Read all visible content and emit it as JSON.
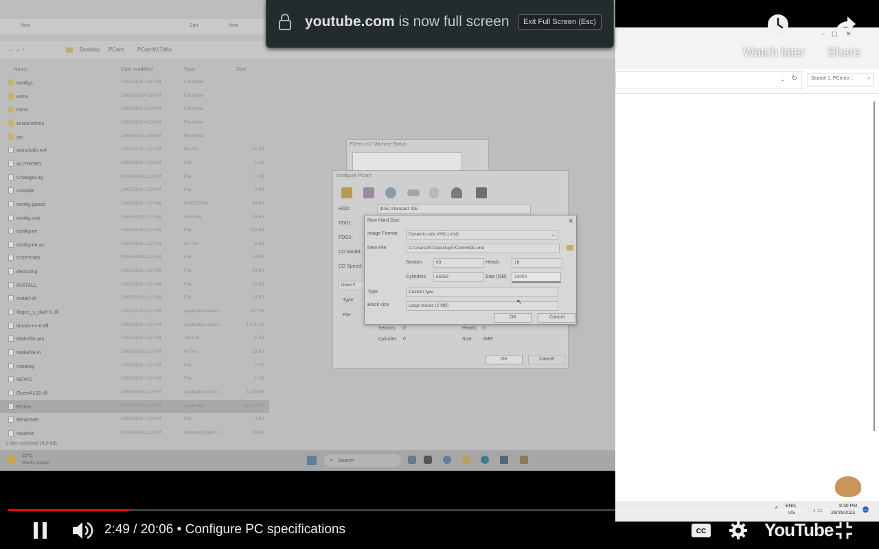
{
  "fullscreen_banner": {
    "domain": "youtube.com",
    "message": "is now full screen",
    "exit_button": "Exit Full Screen (Esc)"
  },
  "top_controls": {
    "watch_later": "Watch later",
    "share": "Share"
  },
  "player": {
    "current_time": "2:49",
    "duration": "20:06",
    "chapter": "Configure PC specifications",
    "progress": 0.14,
    "logo_text": "YouTube",
    "accent_color": "#ff0000"
  },
  "explorer": {
    "toolbar": [
      "New",
      "Sort",
      "View"
    ],
    "breadcrumb": [
      "Desktop",
      "PCem",
      "PCemV17Win"
    ],
    "columns": [
      "Name",
      "Date modified",
      "Type",
      "Size"
    ],
    "files": [
      {
        "name": "configs",
        "date": "20/05/2023 4:16 PM",
        "type": "File folder",
        "size": "",
        "icon": "folder-icon"
      },
      {
        "name": "extra",
        "date": "20/05/2023 4:16 PM",
        "type": "File folder",
        "size": "",
        "icon": "folder-icon"
      },
      {
        "name": "roms",
        "date": "20/05/2023 5:04 PM",
        "type": "File folder",
        "size": "",
        "icon": "folder-icon"
      },
      {
        "name": "screenshots",
        "date": "20/05/2023 4:25 PM",
        "type": "File folder",
        "size": "",
        "icon": "folder-icon"
      },
      {
        "name": "src",
        "date": "20/05/2023 4:16 PM",
        "type": "File folder",
        "size": "",
        "icon": "folder-icon"
      },
      {
        "name": "acinclude.m4",
        "date": "20/05/2023 1:12 PM",
        "type": "M4 File",
        "size": "60 KB",
        "icon": "file-icon"
      },
      {
        "name": "AUTHORS",
        "date": "20/05/2023 1:12 PM",
        "type": "File",
        "size": "1 KB",
        "icon": "file-icon"
      },
      {
        "name": "ChangeLog",
        "date": "20/05/2023 1:12 PM",
        "type": "File",
        "size": "1 KB",
        "icon": "file-icon"
      },
      {
        "name": "compile",
        "date": "20/05/2023 1:12 PM",
        "type": "File",
        "size": "8 KB",
        "icon": "file-icon"
      },
      {
        "name": "config.guess",
        "date": "20/05/2023 1:12 PM",
        "type": "GUESS File",
        "size": "44 KB",
        "icon": "file-icon"
      },
      {
        "name": "config.sub",
        "date": "20/05/2023 1:12 PM",
        "type": "SUB File",
        "size": "35 KB",
        "icon": "file-icon"
      },
      {
        "name": "configure",
        "date": "20/05/2023 1:12 PM",
        "type": "File",
        "size": "250 KB",
        "icon": "file-icon"
      },
      {
        "name": "configure.ac",
        "date": "20/05/2023 1:12 PM",
        "type": "AC File",
        "size": "8 KB",
        "icon": "file-icon"
      },
      {
        "name": "COPYING",
        "date": "20/05/2023 1:12 PM",
        "type": "File",
        "size": "18 KB",
        "icon": "file-icon"
      },
      {
        "name": "depcomp",
        "date": "20/05/2023 1:12 PM",
        "type": "File",
        "size": "24 KB",
        "icon": "file-icon"
      },
      {
        "name": "INSTALL",
        "date": "20/05/2023 1:12 PM",
        "type": "File",
        "size": "16 KB",
        "icon": "file-icon"
      },
      {
        "name": "install-sh",
        "date": "20/05/2023 1:12 PM",
        "type": "File",
        "size": "15 KB",
        "icon": "file-icon"
      },
      {
        "name": "libgcc_s_dw2-1.dll",
        "date": "20/05/2023 1:12 PM",
        "type": "Application exten...",
        "size": "117 KB",
        "icon": "file-icon"
      },
      {
        "name": "libstdc++-6.dll",
        "date": "20/05/2023 1:12 PM",
        "type": "Application exten...",
        "size": "1,371 KB",
        "icon": "file-icon"
      },
      {
        "name": "Makefile.am",
        "date": "20/05/2023 1:12 PM",
        "type": "AM File",
        "size": "1 KB",
        "icon": "file-icon"
      },
      {
        "name": "Makefile.in",
        "date": "20/05/2023 1:12 PM",
        "type": "IN File",
        "size": "23 KB",
        "icon": "file-icon"
      },
      {
        "name": "missing",
        "date": "20/05/2023 1:12 PM",
        "type": "File",
        "size": "7 KB",
        "icon": "file-icon"
      },
      {
        "name": "NEWS",
        "date": "20/05/2023 1:12 PM",
        "type": "File",
        "size": "1 KB",
        "icon": "file-icon"
      },
      {
        "name": "OpenAL32.dll",
        "date": "20/05/2023 1:12 PM",
        "type": "Application exten...",
        "size": "1,315 KB",
        "icon": "file-icon"
      },
      {
        "name": "PCem",
        "date": "20/05/2023 1:12 PM",
        "type": "Application",
        "size": "14,013 KB",
        "icon": "app-icon"
      },
      {
        "name": "README",
        "date": "20/05/2023 1:12 PM",
        "type": "File",
        "size": "4 KB",
        "icon": "file-icon"
      },
      {
        "name": "readme",
        "date": "20/05/2023 1:12 PM",
        "type": "Microsoft Edge H...",
        "size": "36 KB",
        "icon": "edge-icon"
      }
    ],
    "status": "1 item selected  14.0 MB"
  },
  "new_hard_disc": {
    "title": "New Hard Disc",
    "image_format_label": "Image Format",
    "image_format_value": "Dynamic-size VHD (.vhd)",
    "new_file_label": "New File",
    "new_file_value": "C:\\Users\\PC\\Desktop\\PCem\\HDD.vhd",
    "sectors_label": "Sectors",
    "sectors_value": "63",
    "heads_label": "Heads",
    "heads_value": "16",
    "cylinders_label": "Cylinders",
    "cylinders_value": "65015",
    "size_label": "Size (MB)",
    "size_value": "32000",
    "type_label": "Type",
    "type_value": "Custom type",
    "block_size_label": "Block size",
    "block_size_value": "Large blocks (2 MB)",
    "ok": "OK",
    "cancel": "Cancel"
  },
  "configure_dialog": {
    "title": "Configure PCem",
    "hdd_label": "HDD:",
    "hdd_value": "[IDE] Standard IDE",
    "fdd1_label": "FDD1:",
    "fdd2_label": "FDD2:",
    "cd_model_label": "CD Model:",
    "cd_speed_label": "CD Speed:",
    "drive_label": "Drive F",
    "type_label": "Type:",
    "file_label": "File:",
    "sectors_label": "Sectors:",
    "sectors_value": "0",
    "heads_label": "Heads:",
    "heads_value": "0",
    "cylinders_label": "Cylinder:",
    "cylinders_value": "0",
    "size_label": "Size:",
    "size_value": "0MB",
    "ok": "OK",
    "cancel": "Cancel"
  },
  "status_window": {
    "title": "PCem v17 Machine Status"
  },
  "taskbar": {
    "weather_temp": "20°C",
    "weather_desc": "Mostly cloudy",
    "search": "Search"
  },
  "right_screen": {
    "search_placeholder": "Search 1. PCemV...",
    "lang": "ENG",
    "region": "US",
    "clock_time": "8:30 PM",
    "clock_date": "28/05/2023"
  }
}
